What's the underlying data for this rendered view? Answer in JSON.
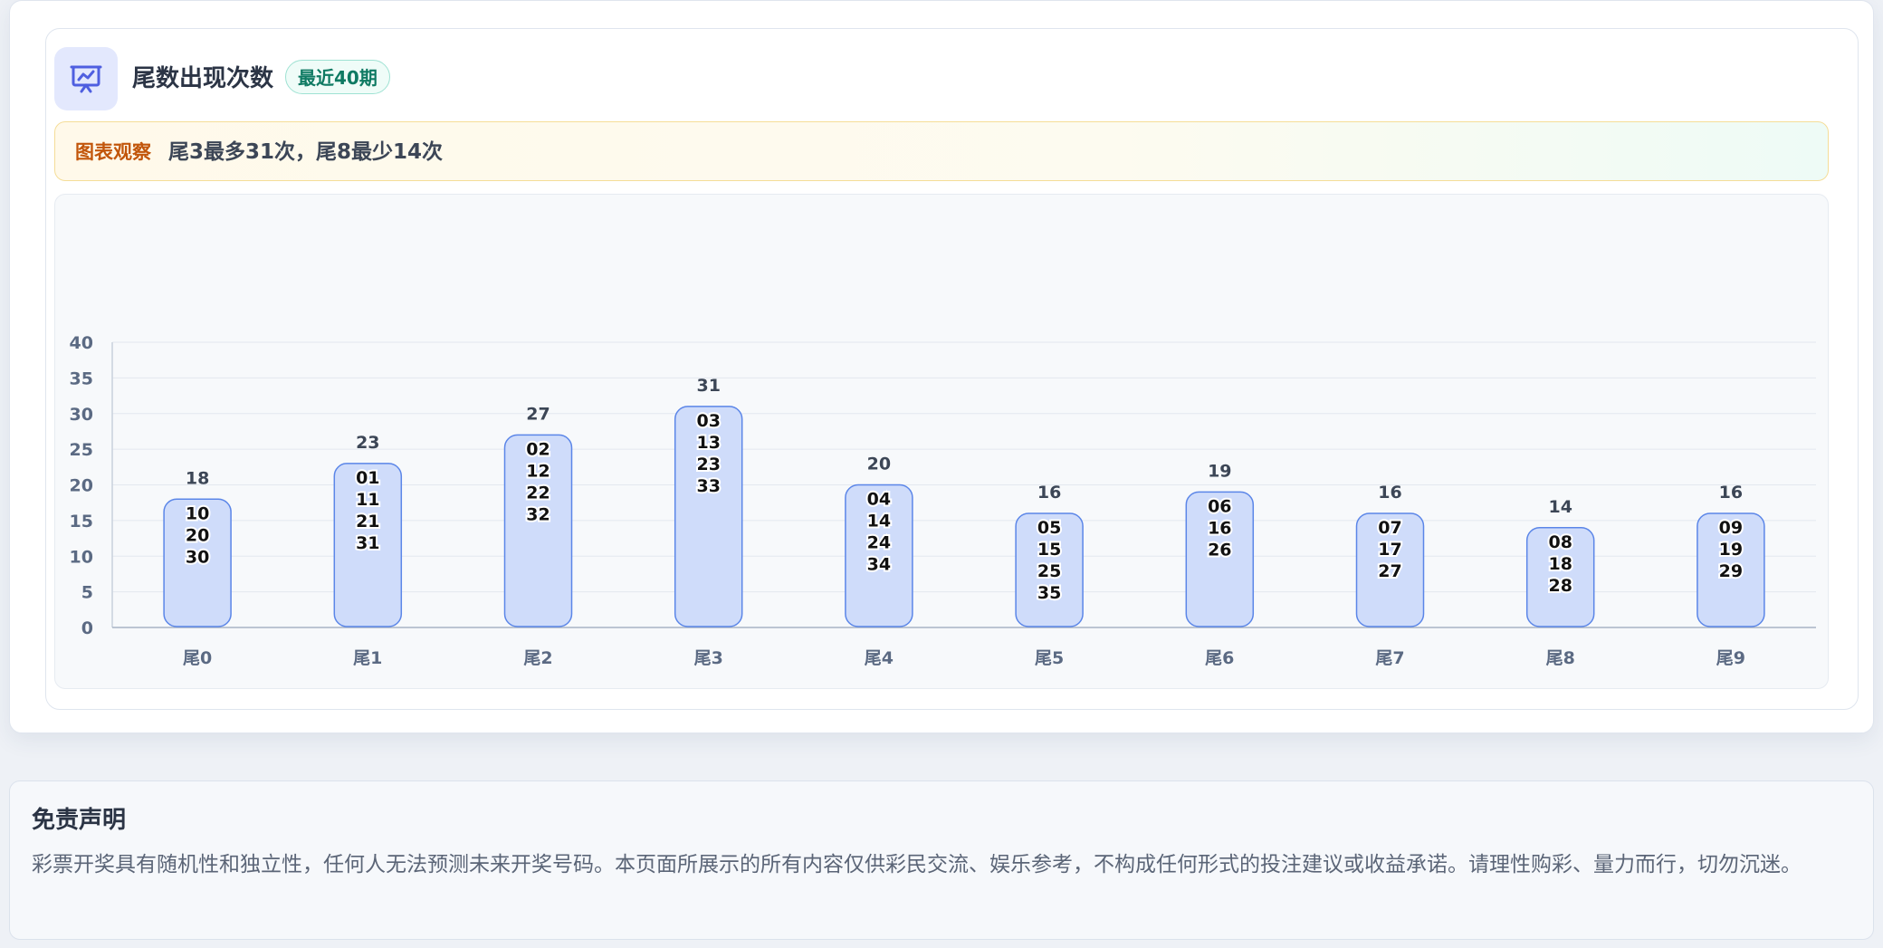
{
  "header": {
    "title": "尾数出现次数",
    "badge": "最近40期",
    "icon": "presentation-chart-icon"
  },
  "insight": {
    "label": "图表观察",
    "text": "尾3最多31次，尾8最少14次"
  },
  "colors": {
    "accent": "#4f6bed",
    "bar_fill": "#cfdcfa",
    "bar_stroke": "#5b86e8",
    "axis_text": "#5b6a83",
    "insight_label": "#c2560b",
    "badge_text": "#0f7a63"
  },
  "chart_data": {
    "type": "bar",
    "categories": [
      "尾0",
      "尾1",
      "尾2",
      "尾3",
      "尾4",
      "尾5",
      "尾6",
      "尾7",
      "尾8",
      "尾9"
    ],
    "values": [
      18,
      23,
      27,
      31,
      20,
      16,
      19,
      16,
      14,
      16
    ],
    "bar_numbers": [
      [
        "10",
        "20",
        "30"
      ],
      [
        "01",
        "11",
        "21",
        "31"
      ],
      [
        "02",
        "12",
        "22",
        "32"
      ],
      [
        "03",
        "13",
        "23",
        "33"
      ],
      [
        "04",
        "14",
        "24",
        "34"
      ],
      [
        "05",
        "15",
        "25",
        "35"
      ],
      [
        "06",
        "16",
        "26"
      ],
      [
        "07",
        "17",
        "27"
      ],
      [
        "08",
        "18",
        "28"
      ],
      [
        "09",
        "19",
        "29"
      ]
    ],
    "y_ticks": [
      "0",
      "5",
      "10",
      "15",
      "20",
      "25",
      "30",
      "35",
      "40"
    ],
    "ylim": [
      0,
      40
    ],
    "grid": true,
    "title": "",
    "xlabel": "",
    "ylabel": ""
  },
  "disclaimer": {
    "title": "免责声明",
    "text": "彩票开奖具有随机性和独立性，任何人无法预测未来开奖号码。本页面所展示的所有内容仅供彩民交流、娱乐参考，不构成任何形式的投注建议或收益承诺。请理性购彩、量力而行，切勿沉迷。"
  }
}
